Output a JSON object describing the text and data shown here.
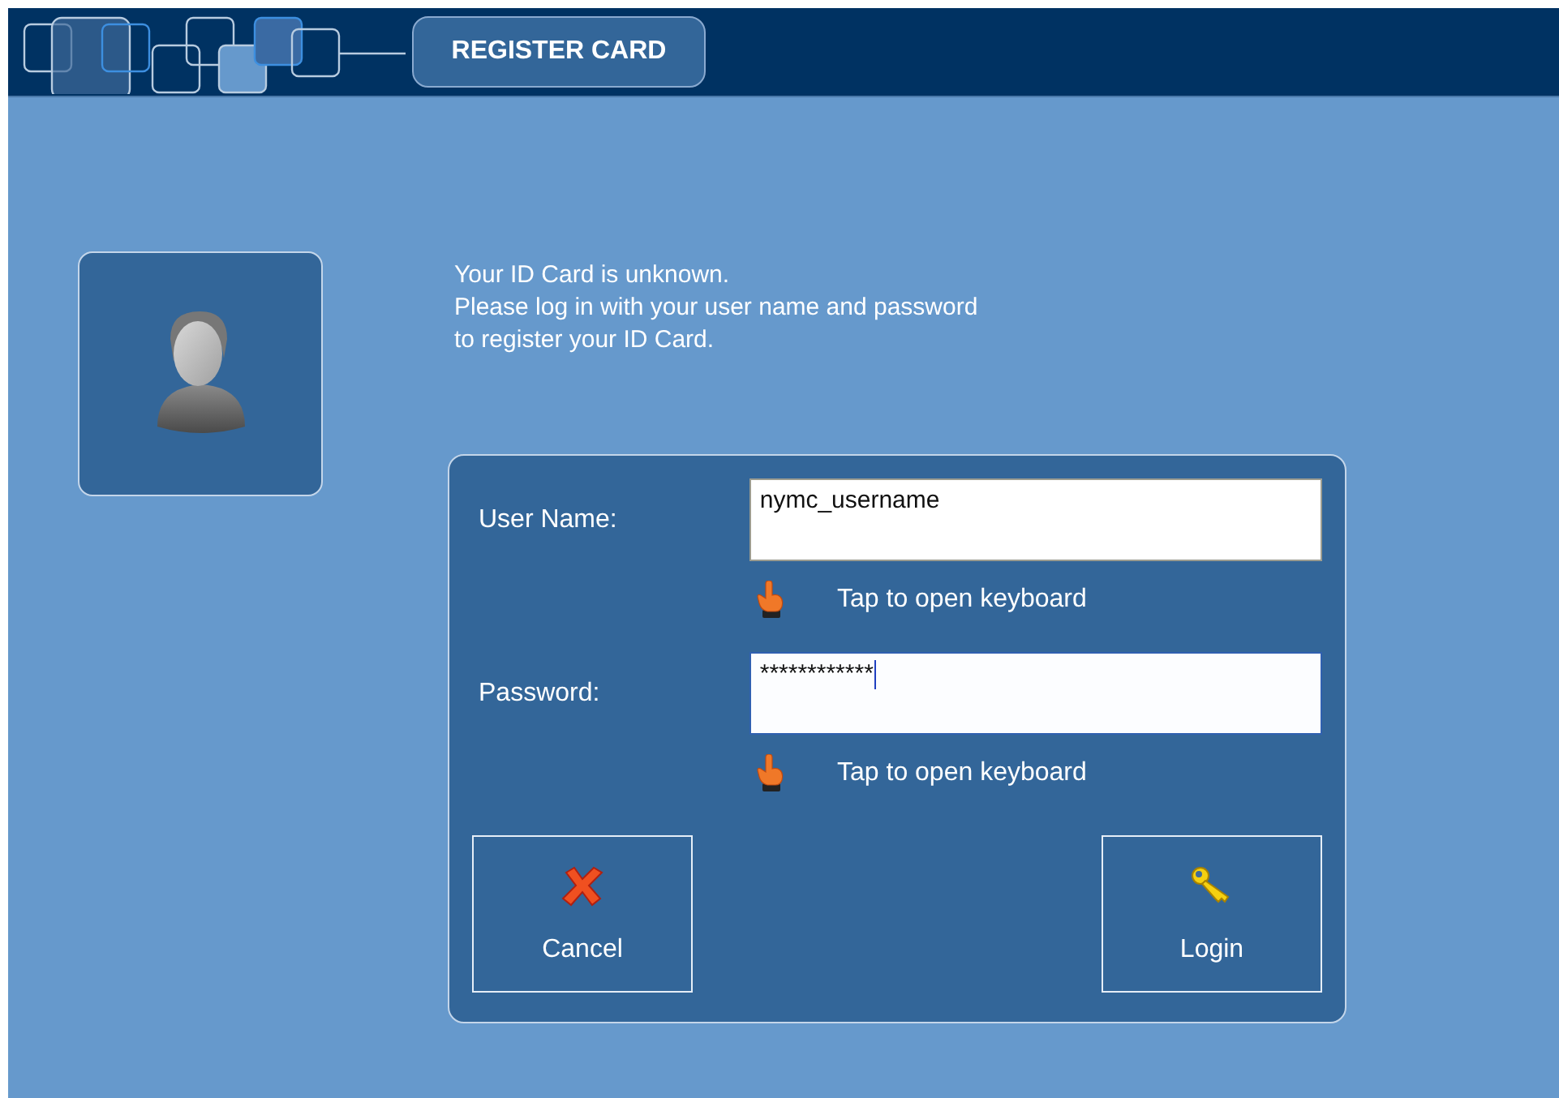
{
  "header": {
    "tab": {
      "label": "REGISTER CARD",
      "selected": true
    }
  },
  "message": {
    "lines": [
      "Your ID Card is unknown.",
      "Please log in with your user name and password",
      "to register your ID Card."
    ]
  },
  "form": {
    "fields": [
      {
        "label": "User Name:",
        "value": "nymc_username",
        "focused": false,
        "hint": "Tap to open keyboard"
      },
      {
        "label": "Password:",
        "value": "************",
        "focused": true,
        "hint": "Tap to open keyboard"
      }
    ],
    "buttons": [
      {
        "kind": "cancel",
        "label": "Cancel"
      },
      {
        "kind": "login",
        "label": "Login"
      }
    ]
  }
}
